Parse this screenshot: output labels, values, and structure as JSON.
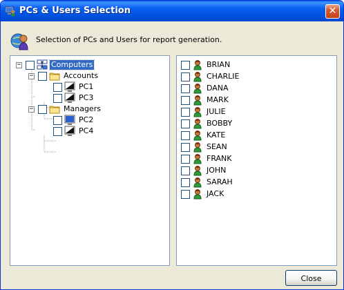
{
  "window": {
    "title": "PCs & Users Selection",
    "description": "Selection of PCs and Users for report generation.",
    "close_glyph": "✕"
  },
  "tree": {
    "root_label": "Computers",
    "groups": [
      {
        "label": "Accounts",
        "pcs": [
          "PC1",
          "PC3"
        ]
      },
      {
        "label": "Managers",
        "pcs": [
          "PC2",
          "PC4"
        ]
      }
    ],
    "expander_glyph": "−"
  },
  "users": [
    "BRIAN",
    "CHARLIE",
    "DANA",
    "MARK",
    "JULIE",
    "BOBBY",
    "KATE",
    "SEAN",
    "FRANK",
    "JOHN",
    "SARAH",
    "JACK"
  ],
  "buttons": {
    "close": "Close"
  },
  "colors": {
    "titlebar": "#0054e3",
    "selection": "#316ac5",
    "panel_border": "#7f9db9",
    "dialog_bg": "#ece9d8"
  },
  "icons": {
    "title": "computer-user-icon",
    "header": "user-globe-icon",
    "root": "network-computers-icon",
    "group": "folder-icon",
    "pc": "monitor-icon",
    "user": "user-icon"
  }
}
